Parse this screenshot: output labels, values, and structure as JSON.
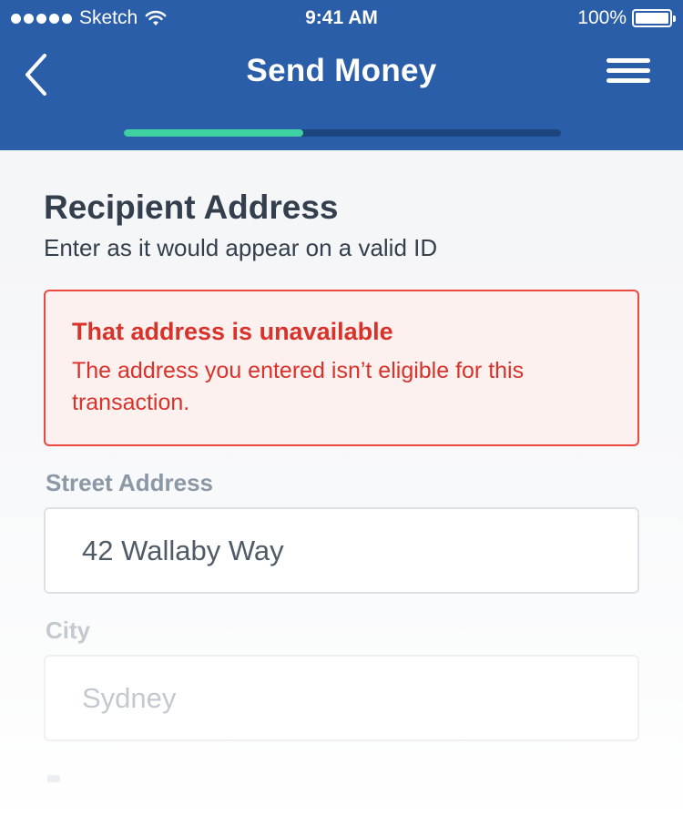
{
  "status_bar": {
    "carrier": "Sketch",
    "time": "9:41 AM",
    "battery": "100%",
    "signal_icon": "signal-dots-icon",
    "wifi_icon": "wifi-icon",
    "battery_icon": "battery-icon"
  },
  "nav": {
    "title": "Send Money",
    "back_icon": "chevron-left-icon",
    "menu_icon": "hamburger-menu-icon",
    "progress": 0.41
  },
  "form": {
    "title": "Recipient Address",
    "subtitle": "Enter as it would appear on a valid ID",
    "error": {
      "title": "That address is unavailable",
      "message": "The address you entered isn’t eligible for this transaction."
    },
    "street": {
      "label": "Street Address",
      "value": "42 Wallaby Way"
    },
    "city": {
      "label": "City",
      "placeholder": "Sydney"
    }
  },
  "colors": {
    "header_bg": "#2a5ea8",
    "progress_fill": "#3fd0a4",
    "progress_track": "#1d467f",
    "error_red": "#d8322a",
    "text_dark": "#333f4c"
  }
}
